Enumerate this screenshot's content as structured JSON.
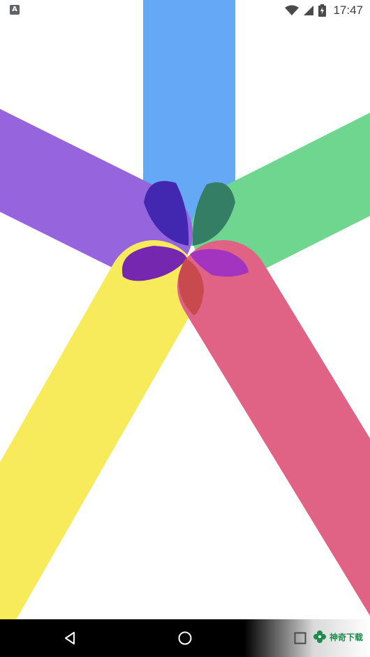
{
  "status_bar": {
    "notification_icon": "a-badge-icon",
    "wifi_icon": "wifi-icon",
    "signal_icon": "cell-signal-icon",
    "battery_icon": "battery-charging-icon",
    "time": "17:47"
  },
  "artwork": {
    "colors": {
      "blue": "#64a8f6",
      "green": "#6ed68f",
      "purple": "#9665de",
      "yellow": "#f7ea5b",
      "red": "#e06284"
    },
    "overlap_colors": {
      "blue_purple": "#4228b0",
      "blue_green": "#347e66",
      "purple_yellow": "#7527b0",
      "green_red": "#a234c0",
      "yellow_red": "#c84a4f"
    }
  },
  "nav_bar": {
    "back_icon": "triangle-back-icon",
    "home_icon": "circle-home-icon",
    "recents_icon": "square-recents-icon"
  },
  "watermark": {
    "text": "神奇下载",
    "logo_icon": "clover-logo-icon"
  }
}
